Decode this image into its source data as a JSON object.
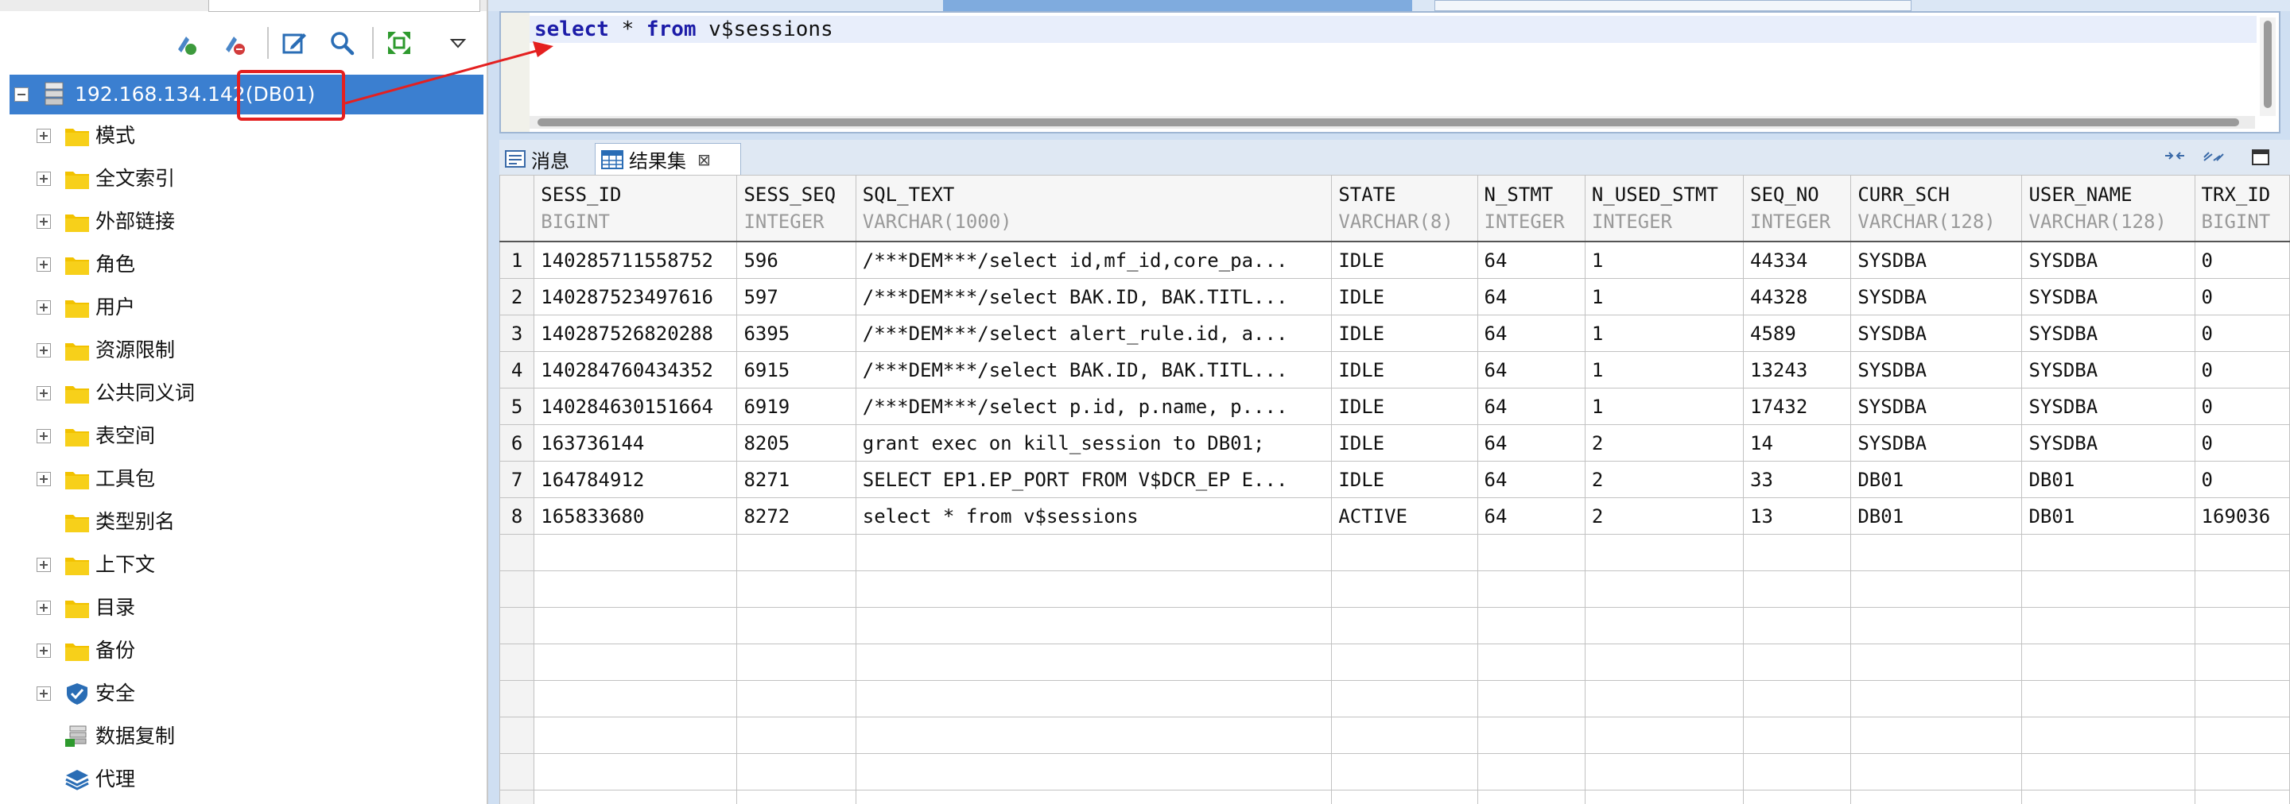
{
  "left_panel": {
    "tree_root": {
      "label": "192.168.134.142(DB01)"
    },
    "tree_items": [
      {
        "label": "模式",
        "icon": "folder-icon",
        "expandable": true
      },
      {
        "label": "全文索引",
        "icon": "folder-icon",
        "expandable": true
      },
      {
        "label": "外部链接",
        "icon": "folder-icon",
        "expandable": true
      },
      {
        "label": "角色",
        "icon": "folder-icon",
        "expandable": true
      },
      {
        "label": "用户",
        "icon": "folder-icon",
        "expandable": true
      },
      {
        "label": "资源限制",
        "icon": "folder-icon",
        "expandable": true
      },
      {
        "label": "公共同义词",
        "icon": "folder-icon",
        "expandable": true
      },
      {
        "label": "表空间",
        "icon": "folder-icon",
        "expandable": true
      },
      {
        "label": "工具包",
        "icon": "folder-icon",
        "expandable": true
      },
      {
        "label": "类型别名",
        "icon": "folder-icon",
        "expandable": false
      },
      {
        "label": "上下文",
        "icon": "folder-icon",
        "expandable": true
      },
      {
        "label": "目录",
        "icon": "folder-icon",
        "expandable": true
      },
      {
        "label": "备份",
        "icon": "folder-icon",
        "expandable": true
      },
      {
        "label": "安全",
        "icon": "shield-icon",
        "expandable": true
      },
      {
        "label": "数据复制",
        "icon": "replication-icon",
        "expandable": false
      },
      {
        "label": "代理",
        "icon": "layers-icon",
        "expandable": false
      }
    ]
  },
  "editor": {
    "keyword_select": "select",
    "text_star": " * ",
    "keyword_from": "from",
    "text_table": " v$sessions"
  },
  "result_tabs": [
    {
      "label": "消息",
      "icon": "message-icon",
      "active": false
    },
    {
      "label": "结果集",
      "icon": "table-icon",
      "active": true,
      "close": "⊠"
    }
  ],
  "result_grid": {
    "columns": [
      {
        "name": "SESS_ID",
        "type": "BIGINT"
      },
      {
        "name": "SESS_SEQ",
        "type": "INTEGER"
      },
      {
        "name": "SQL_TEXT",
        "type": "VARCHAR(1000)"
      },
      {
        "name": "STATE",
        "type": "VARCHAR(8)"
      },
      {
        "name": "N_STMT",
        "type": "INTEGER"
      },
      {
        "name": "N_USED_STMT",
        "type": "INTEGER"
      },
      {
        "name": "SEQ_NO",
        "type": "INTEGER"
      },
      {
        "name": "CURR_SCH",
        "type": "VARCHAR(128)"
      },
      {
        "name": "USER_NAME",
        "type": "VARCHAR(128)"
      },
      {
        "name": "TRX_ID",
        "type": "BIGINT"
      }
    ],
    "rows": [
      [
        "1",
        "140285711558752",
        "596",
        "/***DEM***/select id,mf_id,core_pa...",
        "IDLE",
        "64",
        "1",
        "44334",
        "SYSDBA",
        "SYSDBA",
        "0"
      ],
      [
        "2",
        "140287523497616",
        "597",
        "/***DEM***/select BAK.ID, BAK.TITL...",
        "IDLE",
        "64",
        "1",
        "44328",
        "SYSDBA",
        "SYSDBA",
        "0"
      ],
      [
        "3",
        "140287526820288",
        "6395",
        "/***DEM***/select alert_rule.id, a...",
        "IDLE",
        "64",
        "1",
        "4589",
        "SYSDBA",
        "SYSDBA",
        "0"
      ],
      [
        "4",
        "140284760434352",
        "6915",
        "/***DEM***/select BAK.ID, BAK.TITL...",
        "IDLE",
        "64",
        "1",
        "13243",
        "SYSDBA",
        "SYSDBA",
        "0"
      ],
      [
        "5",
        "140284630151664",
        "6919",
        "/***DEM***/select p.id, p.name, p....",
        "IDLE",
        "64",
        "1",
        "17432",
        "SYSDBA",
        "SYSDBA",
        "0"
      ],
      [
        "6",
        "163736144",
        "8205",
        "grant exec on kill_session to DB01;",
        "IDLE",
        "64",
        "2",
        "14",
        "SYSDBA",
        "SYSDBA",
        "0"
      ],
      [
        "7",
        "164784912",
        "8271",
        "SELECT EP1.EP_PORT FROM V$DCR_EP E...",
        "IDLE",
        "64",
        "2",
        "33",
        "DB01",
        "DB01",
        "0"
      ],
      [
        "8",
        "165833680",
        "8272",
        "select * from v$sessions",
        "ACTIVE",
        "64",
        "2",
        "13",
        "DB01",
        "DB01",
        "169036"
      ]
    ],
    "empty_rows": 8
  },
  "colors": {
    "selection": "#3b7fd0",
    "keyword": "#1c1ca8",
    "annotation": "#e42020",
    "folder": "#f2c200"
  }
}
